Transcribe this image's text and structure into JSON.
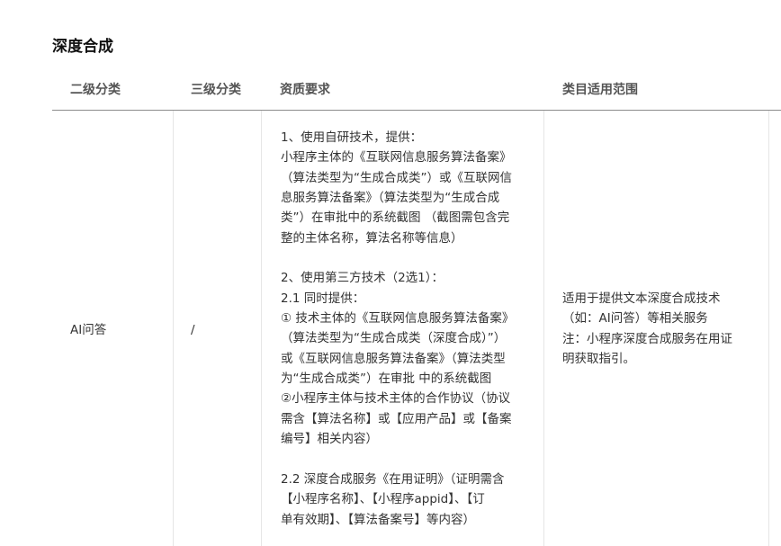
{
  "section": {
    "title": "深度合成"
  },
  "table": {
    "headers": {
      "level2": "二级分类",
      "level3": "三级分类",
      "requirements": "资质要求",
      "scope": "类目适用范围"
    },
    "rows": [
      {
        "level2": "AI问答",
        "level3": "/",
        "requirements": "1、使用自研技术，提供：\n小程序主体的《互联网信息服务算法备案》\n（算法类型为“生成合成类”）或《互联网信\n息服务算法备案》（算法类型为“生成合成\n类”）在审批中的系统截图 （截图需包含完\n整的主体名称，算法名称等信息）\n\n2、使用第三方技术（2选1）：\n2.1 同时提供：\n① 技术主体的《互联网信息服务算法备案》\n（算法类型为“生成合成类（深度合成）”）\n或《互联网信息服务算法备案》（算法类型\n为“生成合成类”）在审批 中的系统截图\n②小程序主体与技术主体的合作协议（协议\n需含【算法名称】或【应用产品】或【备案\n编号】相关内容）\n\n2.2 深度合成服务《在用证明》（证明需含\n【小程序名称】、【小程序appid】、【订\n单有效期】、【算法备案号】等内容）",
        "scope": "适用于提供文本深度合成技术\n（如：AI问答）等相关服务\n注：小程序深度合成服务在用证\n明获取指引。"
      }
    ]
  }
}
